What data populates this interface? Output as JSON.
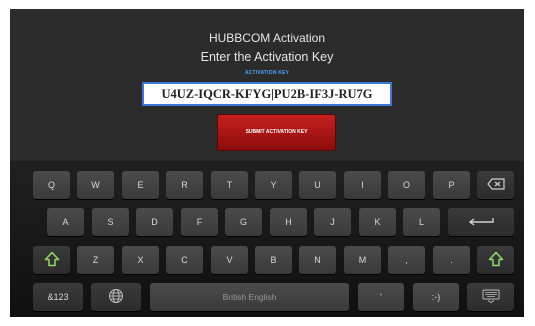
{
  "header": {
    "title": "HUBBCOM Activation",
    "subtitle": "Enter the Activation Key",
    "field_label": "ACTIVATION KEY"
  },
  "activation": {
    "key_value": "U4UZ-IQCR-KFYG|PU2B-IF3J-RU7G",
    "submit_label": "SUBMIT ACTIVATION KEY"
  },
  "keyboard": {
    "row1": [
      "Q",
      "W",
      "E",
      "R",
      "T",
      "Y",
      "U",
      "I",
      "O",
      "P"
    ],
    "row2": [
      "A",
      "S",
      "D",
      "F",
      "G",
      "H",
      "J",
      "K",
      "L"
    ],
    "row3": [
      "Z",
      "X",
      "C",
      "V",
      "B",
      "N",
      "M",
      ",",
      "."
    ],
    "numbers_key": "&123",
    "space_label": "British English",
    "apostrophe_key": "'",
    "smiley_key": ":-)",
    "icons": {
      "backspace": "backspace-icon",
      "enter": "enter-icon",
      "shift": "shift-icon",
      "globe": "globe-icon",
      "hide_keyboard": "keyboard-hide-icon"
    },
    "shift_color": "#8fdc62"
  }
}
